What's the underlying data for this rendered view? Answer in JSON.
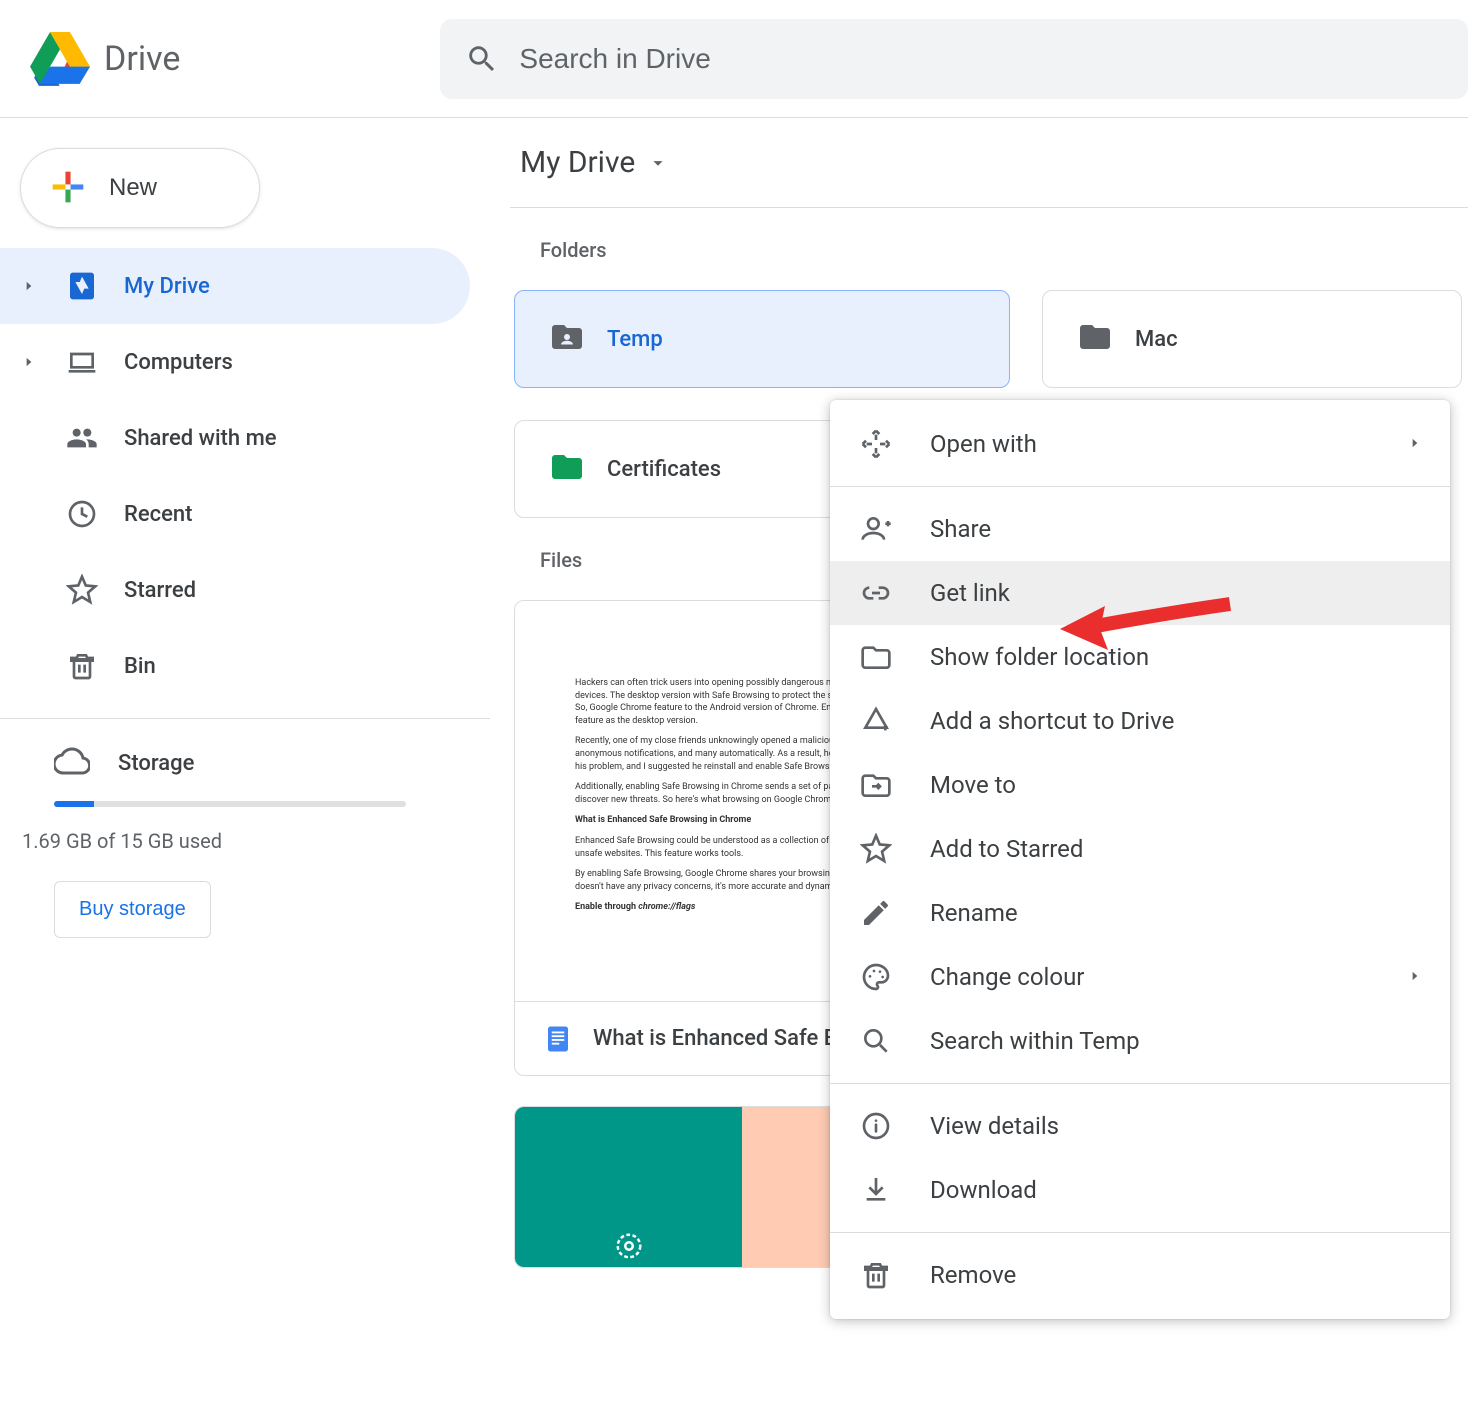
{
  "header": {
    "app_title": "Drive",
    "search_placeholder": "Search in Drive"
  },
  "sidebar": {
    "new_label": "New",
    "items": [
      {
        "label": "My Drive"
      },
      {
        "label": "Computers"
      },
      {
        "label": "Shared with me"
      },
      {
        "label": "Recent"
      },
      {
        "label": "Starred"
      },
      {
        "label": "Bin"
      }
    ],
    "storage_label": "Storage",
    "storage_used_text": "1.69 GB of 15 GB used",
    "buy_label": "Buy storage"
  },
  "main": {
    "breadcrumb": "My Drive",
    "folders_title": "Folders",
    "files_title": "Files",
    "folders": [
      {
        "name": "Temp"
      },
      {
        "name": "Mac"
      },
      {
        "name": "Certificates"
      }
    ],
    "files": [
      {
        "name": "What is Enhanced Safe Browsing"
      }
    ]
  },
  "context_menu": {
    "items": [
      {
        "label": "Open with",
        "submenu": true
      },
      {
        "label": "Share"
      },
      {
        "label": "Get link",
        "highlighted": true
      },
      {
        "label": "Show folder location"
      },
      {
        "label": "Add a shortcut to Drive"
      },
      {
        "label": "Move to"
      },
      {
        "label": "Add to Starred"
      },
      {
        "label": "Rename"
      },
      {
        "label": "Change colour",
        "submenu": true
      },
      {
        "label": "Search within Temp"
      },
      {
        "label": "View details"
      },
      {
        "label": "Download"
      },
      {
        "label": "Remove"
      }
    ]
  }
}
